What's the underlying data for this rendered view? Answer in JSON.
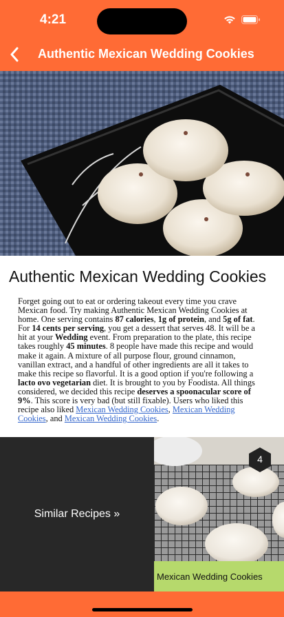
{
  "status_bar": {
    "time": "4:21"
  },
  "nav": {
    "title": "Authentic Mexican Wedding Cookies"
  },
  "colors": {
    "brand": "#ff6b35",
    "card_caption": "#b6d96c",
    "dark_panel": "#282828",
    "link": "#3366cc"
  },
  "recipe": {
    "title": "Authentic Mexican Wedding Cookies",
    "summary": {
      "p1": "Forget going out to eat or ordering takeout every time you crave Mexican food. Try making Authentic Mexican Wedding Cookies at home. One serving contains ",
      "calories": "87 calories",
      "p2": ", ",
      "protein": "1g of protein",
      "p3": ", and ",
      "fat": "5g of fat",
      "p4": ". For ",
      "cost": "14 cents per serving",
      "p5": ", you get a dessert that serves 48. It will be a hit at your ",
      "occasion": "Wedding",
      "p6": " event. From preparation to the plate, this recipe takes roughly ",
      "time": "45 minutes",
      "p7": ". 8 people have made this recipe and would make it again. A mixture of all purpose flour, ground cinnamon, vanillan extract, and a handful of other ingredients are all it takes to make this recipe so flavorful. It is a good option if you're following a ",
      "diet": "lacto ovo vegetarian",
      "p8": " diet. It is brought to you by Foodista. All things considered, we decided this recipe ",
      "score": "deserves a spoonacular score of 9%",
      "p9": ". This score is very bad (but still fixable). Users who liked this recipe also liked ",
      "link1": "Mexican Wedding Cookies",
      "p10": ", ",
      "link2": "Mexican Wedding Cookies",
      "p11": ", and ",
      "link3": "Mexican Wedding Cookies",
      "p12": "."
    }
  },
  "similar": {
    "label": "Similar Recipes »",
    "card": {
      "title": "Mexican Wedding Cookies",
      "badge": "4"
    }
  }
}
